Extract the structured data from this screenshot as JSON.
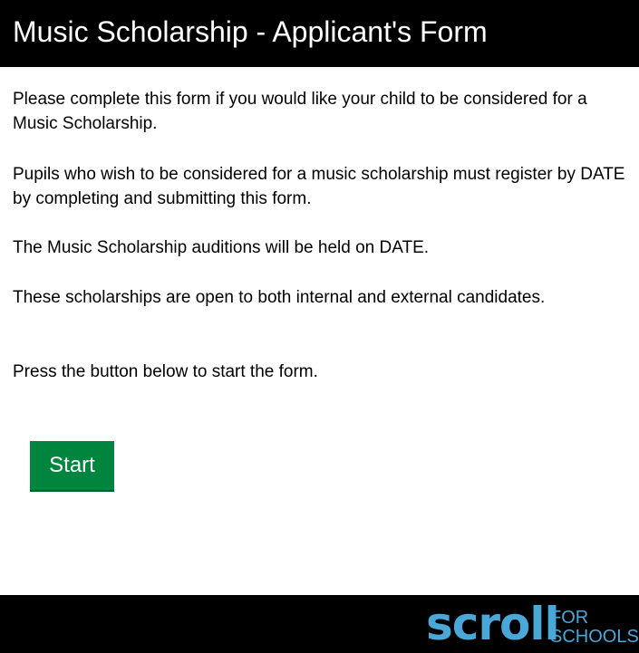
{
  "header": {
    "title": "Music Scholarship - Applicant's Form"
  },
  "content": {
    "paragraphs": [
      "Please complete this form if you would like your child to be considered for a Music Scholarship.",
      "Pupils who wish to be considered for a music scholarship must register by DATE by completing and submitting this form.",
      "The Music Scholarship auditions will be held on DATE.",
      "These scholarships are open to both internal and external candidates.",
      "Press the button below to start the form."
    ]
  },
  "start_button": {
    "label": "Start",
    "color": "#00853f"
  },
  "footer": {
    "logo": {
      "word": "scroll",
      "for": "FOR",
      "schools": "SCHOOLS",
      "color": "#4aa7d8"
    }
  }
}
